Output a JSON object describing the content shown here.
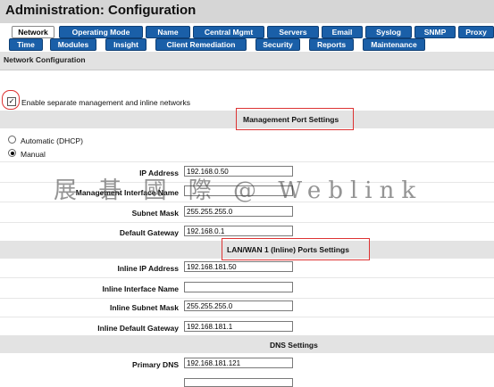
{
  "title": "Administration: Configuration",
  "tabs_row1": [
    {
      "label": "Network",
      "active": true
    },
    {
      "label": "Operating Mode",
      "active": false
    },
    {
      "label": "Name",
      "active": false
    },
    {
      "label": "Central Mgmt",
      "active": false
    },
    {
      "label": "Servers",
      "active": false
    },
    {
      "label": "Email",
      "active": false
    },
    {
      "label": "Syslog",
      "active": false
    },
    {
      "label": "SNMP",
      "active": false
    },
    {
      "label": "Proxy",
      "active": false
    }
  ],
  "tabs_row2": [
    {
      "label": "Time"
    },
    {
      "label": "Modules"
    },
    {
      "label": "Insight"
    },
    {
      "label": "Client Remediation"
    },
    {
      "label": "Security"
    },
    {
      "label": "Reports"
    },
    {
      "label": "Maintenance"
    }
  ],
  "section_label": "Network Configuration",
  "separate_networks": {
    "label": "Enable separate management and inline networks",
    "checked": true
  },
  "mgmt_header": "Management Port Settings",
  "radio_dhcp": {
    "label": "Automatic (DHCP)",
    "selected": false
  },
  "radio_manual": {
    "label": "Manual",
    "selected": true
  },
  "fields_mgmt": {
    "ip_label": "IP Address",
    "ip_value": "192.168.0.50",
    "iface_label": "Management Interface Name",
    "iface_value": "",
    "subnet_label": "Subnet Mask",
    "subnet_value": "255.255.255.0",
    "gateway_label": "Default Gateway",
    "gateway_value": "192.168.0.1"
  },
  "inline_header": "LAN/WAN 1 (Inline) Ports Settings",
  "fields_inline": {
    "ip_label": "Inline IP Address",
    "ip_value": "192.168.181.50",
    "iface_label": "Inline Interface Name",
    "iface_value": "",
    "subnet_label": "Inline Subnet Mask",
    "subnet_value": "255.255.255.0",
    "gateway_label": "Inline Default Gateway",
    "gateway_value": "192.168.181.1"
  },
  "dns_header": "DNS Settings",
  "dns": {
    "primary_label": "Primary DNS",
    "primary_value": "192.168.181.121"
  },
  "watermark": "展 碁 國 際 @ Weblink"
}
